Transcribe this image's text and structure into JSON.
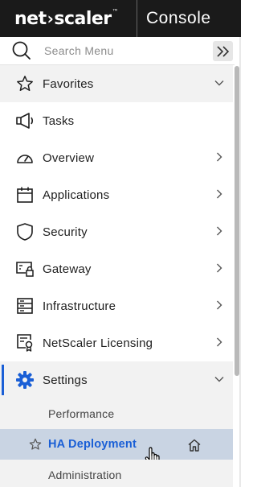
{
  "header": {
    "logo_net": "net",
    "logo_scaler": "scaler",
    "logo_tm": "™",
    "product": "Console"
  },
  "search": {
    "placeholder": "Search Menu"
  },
  "menu": {
    "favorites": "Favorites",
    "tasks": "Tasks",
    "overview": "Overview",
    "applications": "Applications",
    "security": "Security",
    "gateway": "Gateway",
    "infrastructure": "Infrastructure",
    "licensing": "NetScaler Licensing",
    "settings": "Settings"
  },
  "settings_sub": {
    "performance": "Performance",
    "ha_deployment": "HA Deployment",
    "administration": "Administration"
  },
  "colors": {
    "topbar": "#1a1a1a",
    "accent": "#1a5fd6",
    "active_row": "#c9d4e3"
  }
}
